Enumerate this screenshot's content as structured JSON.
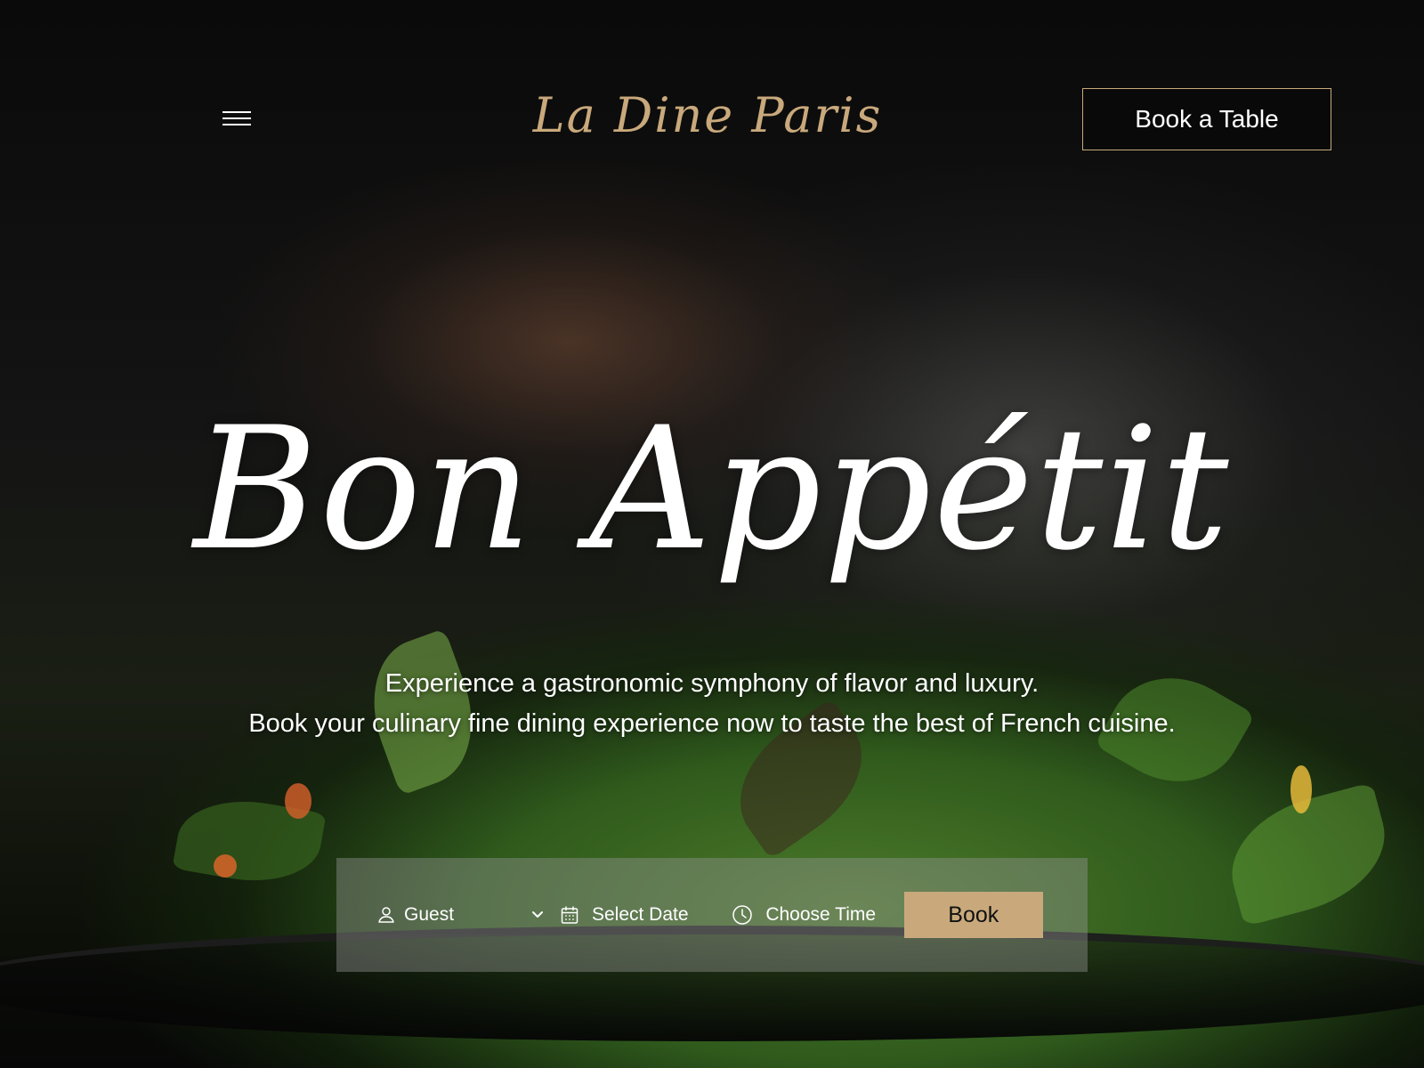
{
  "header": {
    "menu_icon": "hamburger-menu-icon",
    "logo_text": "La Dine Paris",
    "book_table_label": "Book a Table"
  },
  "hero": {
    "title": "Bon Appétit",
    "tagline_line1": "Experience a gastronomic symphony of flavor and luxury.",
    "tagline_line2": "Book your culinary fine dining experience now to taste the best of French cuisine."
  },
  "booking": {
    "guest_label": "Guest",
    "guest_icon": "person-icon",
    "guest_dropdown_icon": "chevron-down-icon",
    "date_label": "Select Date",
    "date_icon": "calendar-icon",
    "time_label": "Choose Time",
    "time_icon": "clock-icon",
    "book_label": "Book"
  },
  "colors": {
    "accent_gold": "#c9a97c",
    "text_white": "#ffffff",
    "booking_bar_bg": "rgba(150,150,150,0.42)"
  }
}
